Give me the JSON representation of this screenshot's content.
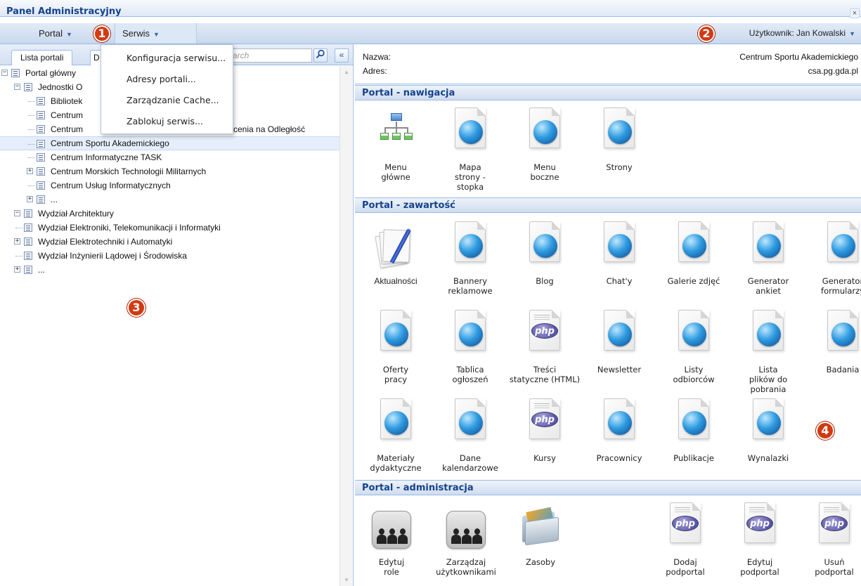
{
  "window": {
    "title": "Panel Administracyjny",
    "close_label": "×"
  },
  "menubar": {
    "portal_label": "Portal",
    "serwis_label": "Serwis",
    "arrow": "▼",
    "badge1": "1",
    "badge2": "2",
    "user_label": "Użytkownik: Jan Kowalski"
  },
  "dropdown": {
    "items": [
      "Konfiguracja serwisu...",
      "Adresy portali...",
      "Zarządzanie Cache...",
      "Zablokuj serwis..."
    ]
  },
  "left": {
    "tabs": [
      "Lista portali",
      "D"
    ],
    "search_placeholder": "arch",
    "collapse_label": "«",
    "badge3": "3"
  },
  "tree": [
    {
      "label": "Portal główny",
      "level": 0,
      "expander": "minus"
    },
    {
      "label": "Jednostki O",
      "level": 1,
      "expander": "minus"
    },
    {
      "label": "Bibliotek",
      "level": 2,
      "expander": "none"
    },
    {
      "label": "Centrum",
      "level": 2,
      "expander": "none"
    },
    {
      "label": "Centrum",
      "suffix": "cenia na Odległość",
      "level": 2,
      "expander": "none"
    },
    {
      "label": "Centrum Sportu Akademickiego",
      "level": 2,
      "expander": "none",
      "selected": true
    },
    {
      "label": "Centrum Informatyczne TASK",
      "level": 2,
      "expander": "none"
    },
    {
      "label": "Centrum Morskich Technologii Militarnych",
      "level": 2,
      "expander": "plus"
    },
    {
      "label": "Centrum Usług Informatycznych",
      "level": 2,
      "expander": "none"
    },
    {
      "label": "...",
      "level": 2,
      "expander": "plus"
    },
    {
      "label": "Wydział Architektury",
      "level": 1,
      "expander": "minus"
    },
    {
      "label": "Wydział Elektroniki, Telekomunikacji i Informatyki",
      "level": 1,
      "expander": "none"
    },
    {
      "label": "Wydział Elektrotechniki i Automatyki",
      "level": 1,
      "expander": "plus"
    },
    {
      "label": "Wydział Inżynierii Lądowej i Środowiska",
      "level": 1,
      "expander": "none"
    },
    {
      "label": "...",
      "level": 1,
      "expander": "plus"
    }
  ],
  "info": {
    "nazwa_key": "Nazwa:",
    "nazwa_value": "Centrum Sportu Akademickiego",
    "adres_key": "Adres:",
    "adres_value": "csa.pg.gda.pl"
  },
  "sections": {
    "nawigacja": "Portal - nawigacja",
    "zawartosc": "Portal - zawartość",
    "administracja": "Portal - administracja",
    "badge4": "4"
  },
  "nav_tiles": [
    {
      "label": "Menu\ngłówne",
      "icon": "sitemap-icon"
    },
    {
      "label": "Mapa\nstrony -\nstopka",
      "icon": "globe-document-icon"
    },
    {
      "label": "Menu\nboczne",
      "icon": "globe-document-icon"
    },
    {
      "label": "Strony",
      "icon": "globe-document-icon"
    }
  ],
  "content_tiles": [
    {
      "label": "Aktualności",
      "icon": "news-icon"
    },
    {
      "label": "Bannery\nreklamowe",
      "icon": "globe-document-icon"
    },
    {
      "label": "Blog",
      "icon": "globe-document-icon"
    },
    {
      "label": "Chat'y",
      "icon": "globe-document-icon"
    },
    {
      "label": "Galerie zdjęć",
      "icon": "globe-document-icon"
    },
    {
      "label": "Generator\nankiet",
      "icon": "globe-document-icon"
    },
    {
      "label": "Generator\nformularzy",
      "icon": "globe-document-icon"
    },
    {
      "label": "Oferty\npracy",
      "icon": "globe-document-icon"
    },
    {
      "label": "Tablica\nogłoszeń",
      "icon": "globe-document-icon"
    },
    {
      "label": "Treści\nstatyczne (HTML)",
      "icon": "php-document-icon"
    },
    {
      "label": "Newsletter",
      "icon": "globe-document-icon"
    },
    {
      "label": "Listy\nodbiorców",
      "icon": "globe-document-icon"
    },
    {
      "label": "Lista\nplików do\npobrania",
      "icon": "globe-document-icon"
    },
    {
      "label": "Badania",
      "icon": "globe-document-icon"
    },
    {
      "label": "Materiały\ndydaktyczne",
      "icon": "globe-document-icon"
    },
    {
      "label": "Dane\nkalendarzowe",
      "icon": "globe-document-icon"
    },
    {
      "label": "Kursy",
      "icon": "php-document-icon"
    },
    {
      "label": "Pracownicy",
      "icon": "globe-document-icon"
    },
    {
      "label": "Publikacje",
      "icon": "globe-document-icon"
    },
    {
      "label": "Wynalazki",
      "icon": "globe-document-icon"
    }
  ],
  "admin_tiles": [
    {
      "label": "Edytuj\nrole",
      "icon": "people-icon"
    },
    {
      "label": "Zarządzaj\nużytkownikami",
      "icon": "people-icon"
    },
    {
      "label": "Zasoby",
      "icon": "folder-icon"
    },
    {
      "label": "Dodaj\npodportal",
      "icon": "php-document-icon"
    },
    {
      "label": "Edytuj\npodportal",
      "icon": "php-document-icon"
    },
    {
      "label": "Usuń\npodportal",
      "icon": "php-document-icon"
    }
  ],
  "php_text": "php",
  "colors": {
    "header_text": "#15428b",
    "badge": "#d23a12",
    "border": "#99bbe8"
  }
}
